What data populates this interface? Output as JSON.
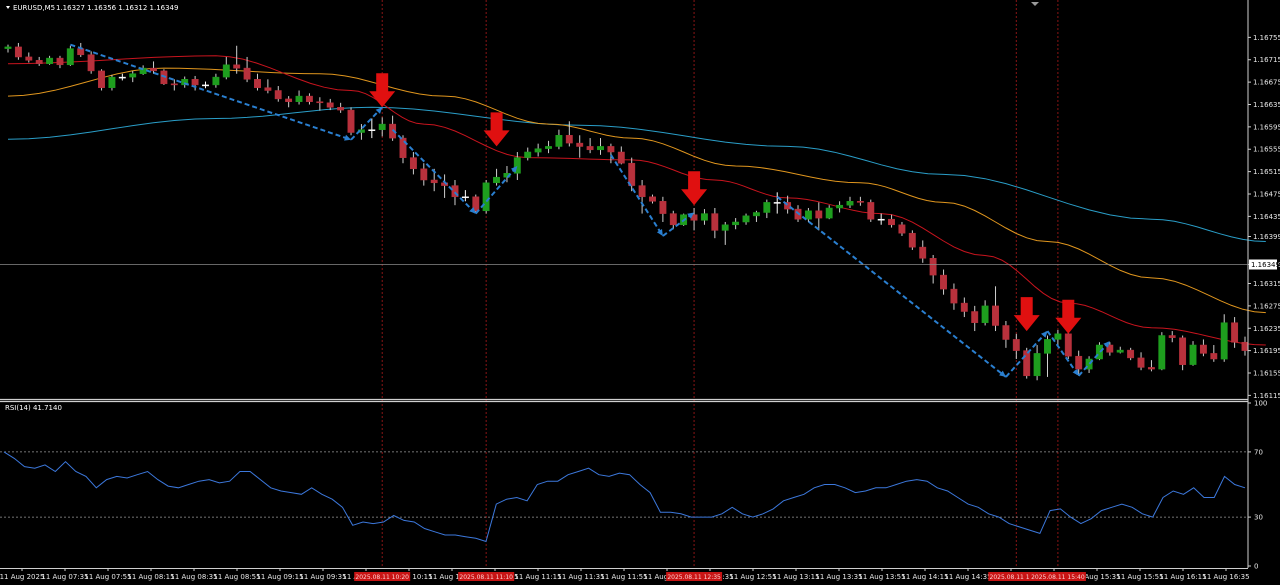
{
  "header": {
    "symbol": "EURUSD,M5",
    "ohlc": "1.16327 1.16356 1.16312 1.16349"
  },
  "rsi_panel": {
    "label": "RSI(14) 41.7140",
    "ticks": [
      "100",
      "70",
      "30",
      "0"
    ]
  },
  "colors": {
    "background": "#000000",
    "bull": "#1e9e1e",
    "bear": "#b8313c",
    "ma_fast": "#c8141e",
    "ma_mid": "#e0961e",
    "ma_slow": "#2a9ec8",
    "rsi": "#3c78dc",
    "grid_vline": "#8a1515",
    "arrow": "#e01010",
    "trend": "#2a7fd0",
    "price_marker_bg": "#ffffff"
  },
  "chart_data": {
    "type": "candlestick",
    "title": "EURUSD,M5",
    "y_ticks": [
      "1.16755",
      "1.16715",
      "1.16675",
      "1.16635",
      "1.16595",
      "1.16555",
      "1.16515",
      "1.16475",
      "1.16435",
      "1.16399",
      "1.16349",
      "1.16315",
      "1.16275",
      "1.16235",
      "1.16195",
      "1.16155",
      "1.16115"
    ],
    "ylim": [
      1.16113,
      1.16778
    ],
    "current_price": "1.16349",
    "x_labels": [
      "11 Aug 2025",
      "11 Aug 07:35",
      "11 Aug 07:55",
      "11 Aug 08:15",
      "11 Aug 08:35",
      "11 Aug 08:55",
      "11 Aug 09:15",
      "11 Aug 09:35",
      "11 Aug 09:55",
      "11 Aug 10:15",
      "11 Aug 10:35",
      "11 Aug 10:55",
      "11 Aug 11:15",
      "11 Aug 11:35",
      "11 Aug 11:55",
      "11 Aug 12:15",
      "11 Aug 12:35",
      "11 Aug 12:55",
      "11 Aug 13:15",
      "11 Aug 13:35",
      "11 Aug 13:55",
      "11 Aug 14:15",
      "11 Aug 14:35",
      "11 Aug 14:55",
      "11 Aug 15:15",
      "11 Aug 15:35",
      "11 Aug 15:55",
      "11 Aug 16:15",
      "11 Aug 16:35"
    ],
    "highlighted_times": [
      "2025.08.11 10:20",
      "2025.08.11 11:10",
      "2025.08.11 12:35",
      "2025.08.11 15:20",
      "2025.08.11 15:40"
    ],
    "ohlc": [
      [
        1.16735,
        1.16742,
        1.16728,
        1.16738
      ],
      [
        1.16738,
        1.16745,
        1.16715,
        1.1672
      ],
      [
        1.1672,
        1.16728,
        1.1671,
        1.16714
      ],
      [
        1.16714,
        1.1672,
        1.16704,
        1.16708
      ],
      [
        1.16708,
        1.16722,
        1.16706,
        1.16718
      ],
      [
        1.16718,
        1.16722,
        1.167,
        1.16706
      ],
      [
        1.16706,
        1.1674,
        1.16704,
        1.16735
      ],
      [
        1.16735,
        1.16745,
        1.1672,
        1.16724
      ],
      [
        1.16724,
        1.1673,
        1.1669,
        1.16695
      ],
      [
        1.16695,
        1.16698,
        1.1666,
        1.16665
      ],
      [
        1.16665,
        1.16688,
        1.1666,
        1.16684
      ],
      [
        1.16684,
        1.1669,
        1.16678,
        1.16684
      ],
      [
        1.16684,
        1.16695,
        1.16675,
        1.1669
      ],
      [
        1.1669,
        1.16705,
        1.16688,
        1.167
      ],
      [
        1.167,
        1.16712,
        1.1669,
        1.16695
      ],
      [
        1.16695,
        1.16698,
        1.1667,
        1.16672
      ],
      [
        1.16672,
        1.1668,
        1.1666,
        1.1667
      ],
      [
        1.1667,
        1.16685,
        1.16665,
        1.1668
      ],
      [
        1.1668,
        1.16686,
        1.1666,
        1.1667
      ],
      [
        1.1667,
        1.16676,
        1.16664,
        1.1667
      ],
      [
        1.1667,
        1.1669,
        1.16665,
        1.16684
      ],
      [
        1.16684,
        1.1672,
        1.1668,
        1.16706
      ],
      [
        1.16706,
        1.1674,
        1.1669,
        1.167
      ],
      [
        1.167,
        1.1672,
        1.16675,
        1.1668
      ],
      [
        1.1668,
        1.1669,
        1.1666,
        1.16665
      ],
      [
        1.16665,
        1.1668,
        1.16655,
        1.1666
      ],
      [
        1.1666,
        1.16668,
        1.1664,
        1.16645
      ],
      [
        1.16645,
        1.1665,
        1.1663,
        1.1664
      ],
      [
        1.1664,
        1.1666,
        1.16635,
        1.1665
      ],
      [
        1.1665,
        1.16655,
        1.16635,
        1.1664
      ],
      [
        1.1664,
        1.16648,
        1.16624,
        1.16638
      ],
      [
        1.16638,
        1.16645,
        1.16625,
        1.1663
      ],
      [
        1.1663,
        1.16638,
        1.1662,
        1.16625
      ],
      [
        1.16625,
        1.1663,
        1.1658,
        1.16585
      ],
      [
        1.16585,
        1.166,
        1.16572,
        1.1659
      ],
      [
        1.1659,
        1.1661,
        1.16575,
        1.1659
      ],
      [
        1.1659,
        1.16612,
        1.16578,
        1.166
      ],
      [
        1.166,
        1.16615,
        1.1657,
        1.16575
      ],
      [
        1.16575,
        1.1658,
        1.1653,
        1.1654
      ],
      [
        1.1654,
        1.1655,
        1.1651,
        1.1652
      ],
      [
        1.1652,
        1.1653,
        1.1649,
        1.165
      ],
      [
        1.165,
        1.1652,
        1.1648,
        1.16495
      ],
      [
        1.16495,
        1.1651,
        1.16468,
        1.1649
      ],
      [
        1.1649,
        1.165,
        1.16455,
        1.1647
      ],
      [
        1.1647,
        1.16482,
        1.16462,
        1.1647
      ],
      [
        1.1647,
        1.16474,
        1.1644,
        1.16445
      ],
      [
        1.16445,
        1.165,
        1.1644,
        1.16495
      ],
      [
        1.16495,
        1.1652,
        1.1649,
        1.16505
      ],
      [
        1.16505,
        1.16525,
        1.16496,
        1.16512
      ],
      [
        1.16512,
        1.1655,
        1.165,
        1.1654
      ],
      [
        1.1654,
        1.16558,
        1.16535,
        1.1655
      ],
      [
        1.1655,
        1.16565,
        1.16542,
        1.16556
      ],
      [
        1.16556,
        1.1657,
        1.16548,
        1.1656
      ],
      [
        1.1656,
        1.1659,
        1.16555,
        1.1658
      ],
      [
        1.1658,
        1.16605,
        1.1656,
        1.16566
      ],
      [
        1.16566,
        1.1658,
        1.1654,
        1.1656
      ],
      [
        1.1656,
        1.16575,
        1.16548,
        1.16554
      ],
      [
        1.16554,
        1.16575,
        1.16545,
        1.1656
      ],
      [
        1.1656,
        1.16565,
        1.1653,
        1.1655
      ],
      [
        1.1655,
        1.1656,
        1.16528,
        1.1653
      ],
      [
        1.1653,
        1.1654,
        1.1648,
        1.1649
      ],
      [
        1.1649,
        1.165,
        1.1644,
        1.1647
      ],
      [
        1.1647,
        1.16474,
        1.16458,
        1.16462
      ],
      [
        1.16462,
        1.1647,
        1.16425,
        1.1644
      ],
      [
        1.1644,
        1.16445,
        1.16412,
        1.1642
      ],
      [
        1.1642,
        1.1644,
        1.16418,
        1.16438
      ],
      [
        1.16438,
        1.1645,
        1.1641,
        1.16428
      ],
      [
        1.16428,
        1.16448,
        1.1642,
        1.1644
      ],
      [
        1.1644,
        1.1645,
        1.16396,
        1.1641
      ],
      [
        1.1641,
        1.16425,
        1.16384,
        1.1642
      ],
      [
        1.1642,
        1.16432,
        1.16412,
        1.16425
      ],
      [
        1.16425,
        1.1644,
        1.1642,
        1.16436
      ],
      [
        1.16436,
        1.16445,
        1.16425,
        1.16442
      ],
      [
        1.16442,
        1.16465,
        1.16432,
        1.1646
      ],
      [
        1.1646,
        1.16478,
        1.1644,
        1.1646
      ],
      [
        1.1646,
        1.16472,
        1.1644,
        1.16448
      ],
      [
        1.16448,
        1.16455,
        1.16425,
        1.1643
      ],
      [
        1.1643,
        1.1645,
        1.16425,
        1.16445
      ],
      [
        1.16445,
        1.1646,
        1.1641,
        1.16432
      ],
      [
        1.16432,
        1.16455,
        1.1643,
        1.1645
      ],
      [
        1.1645,
        1.16462,
        1.16442,
        1.16455
      ],
      [
        1.16455,
        1.1647,
        1.1645,
        1.16462
      ],
      [
        1.16462,
        1.1647,
        1.16454,
        1.1646
      ],
      [
        1.1646,
        1.16465,
        1.16425,
        1.1643
      ],
      [
        1.1643,
        1.1644,
        1.1642,
        1.1643
      ],
      [
        1.1643,
        1.16438,
        1.16415,
        1.1642
      ],
      [
        1.1642,
        1.16425,
        1.164,
        1.16405
      ],
      [
        1.16405,
        1.1641,
        1.16375,
        1.1638
      ],
      [
        1.1638,
        1.16392,
        1.16352,
        1.1636
      ],
      [
        1.1636,
        1.16366,
        1.16315,
        1.1633
      ],
      [
        1.1633,
        1.1634,
        1.16295,
        1.16305
      ],
      [
        1.16305,
        1.16315,
        1.16268,
        1.1628
      ],
      [
        1.1628,
        1.1629,
        1.16255,
        1.16265
      ],
      [
        1.16265,
        1.16275,
        1.1623,
        1.16245
      ],
      [
        1.16245,
        1.16285,
        1.1624,
        1.16275
      ],
      [
        1.16275,
        1.1631,
        1.1623,
        1.1624
      ],
      [
        1.1624,
        1.16248,
        1.162,
        1.16215
      ],
      [
        1.16215,
        1.16225,
        1.1618,
        1.16195
      ],
      [
        1.16195,
        1.162,
        1.16145,
        1.1615
      ],
      [
        1.1615,
        1.16205,
        1.16142,
        1.1619
      ],
      [
        1.1619,
        1.16222,
        1.16148,
        1.16215
      ],
      [
        1.16215,
        1.16232,
        1.16205,
        1.16225
      ],
      [
        1.16225,
        1.16235,
        1.1618,
        1.16185
      ],
      [
        1.16185,
        1.16195,
        1.1615,
        1.16162
      ],
      [
        1.16162,
        1.16185,
        1.16155,
        1.1618
      ],
      [
        1.1618,
        1.1621,
        1.16178,
        1.16205
      ],
      [
        1.16205,
        1.1621,
        1.16186,
        1.16192
      ],
      [
        1.16192,
        1.16202,
        1.1619,
        1.16196
      ],
      [
        1.16196,
        1.162,
        1.16178,
        1.16182
      ],
      [
        1.16182,
        1.16192,
        1.1616,
        1.16165
      ],
      [
        1.16165,
        1.16178,
        1.16158,
        1.16162
      ],
      [
        1.16162,
        1.16228,
        1.1616,
        1.16222
      ],
      [
        1.16222,
        1.1623,
        1.1621,
        1.16218
      ],
      [
        1.16218,
        1.16222,
        1.1616,
        1.1617
      ],
      [
        1.1617,
        1.16212,
        1.16168,
        1.16205
      ],
      [
        1.16205,
        1.16215,
        1.16185,
        1.1619
      ],
      [
        1.1619,
        1.16205,
        1.16175,
        1.1618
      ],
      [
        1.1618,
        1.1626,
        1.16175,
        1.16245
      ],
      [
        1.16245,
        1.16255,
        1.162,
        1.1621
      ],
      [
        1.1621,
        1.1622,
        1.16186,
        1.16195
      ]
    ],
    "ma_fast": [
      [
        0,
        1.16708
      ],
      [
        20,
        1.16722
      ],
      [
        33,
        1.1666
      ],
      [
        40,
        1.166
      ],
      [
        50,
        1.1654
      ],
      [
        60,
        1.16536
      ],
      [
        68,
        1.165
      ],
      [
        75,
        1.16468
      ],
      [
        84,
        1.1644
      ],
      [
        94,
        1.16365
      ],
      [
        102,
        1.1628
      ],
      [
        110,
        1.16236
      ],
      [
        121,
        1.16205
      ]
    ],
    "ma_mid": [
      [
        0,
        1.1665
      ],
      [
        15,
        1.167
      ],
      [
        30,
        1.1669
      ],
      [
        42,
        1.1665
      ],
      [
        52,
        1.166
      ],
      [
        60,
        1.16575
      ],
      [
        70,
        1.16525
      ],
      [
        82,
        1.16495
      ],
      [
        90,
        1.1646
      ],
      [
        100,
        1.1639
      ],
      [
        110,
        1.16325
      ],
      [
        121,
        1.16263
      ]
    ],
    "ma_slow": [
      [
        0,
        1.16573
      ],
      [
        20,
        1.1661
      ],
      [
        35,
        1.1663
      ],
      [
        55,
        1.16598
      ],
      [
        75,
        1.1656
      ],
      [
        90,
        1.1651
      ],
      [
        110,
        1.1643
      ],
      [
        121,
        1.1639
      ]
    ],
    "trend_lines": [
      [
        [
          6,
          1.16742
        ],
        [
          33,
          1.16572
        ]
      ],
      [
        [
          33,
          1.16572
        ],
        [
          36,
          1.1663
        ]
      ],
      [
        [
          37,
          1.1659
        ],
        [
          45,
          1.1644
        ]
      ],
      [
        [
          45,
          1.1644
        ],
        [
          49,
          1.16525
        ]
      ],
      [
        [
          58,
          1.16545
        ],
        [
          63,
          1.164
        ]
      ],
      [
        [
          63,
          1.164
        ],
        [
          66,
          1.16442
        ]
      ],
      [
        [
          74,
          1.1647
        ],
        [
          96,
          1.16148
        ]
      ],
      [
        [
          96,
          1.16148
        ],
        [
          100,
          1.1623
        ]
      ],
      [
        [
          100,
          1.1623
        ],
        [
          103,
          1.1615
        ]
      ],
      [
        [
          103,
          1.1615
        ],
        [
          106,
          1.16212
        ]
      ]
    ],
    "signal_arrows": [
      [
        36,
        1.1663
      ],
      [
        47,
        1.1656
      ],
      [
        66,
        1.16455
      ],
      [
        98,
        1.1623
      ],
      [
        102,
        1.16225
      ]
    ],
    "rsi": [
      70,
      66,
      61,
      60,
      62,
      58,
      64,
      58,
      55,
      48,
      53,
      55,
      54,
      56,
      58,
      53,
      49,
      48,
      50,
      52,
      53,
      51,
      52,
      58,
      58,
      53,
      48,
      46,
      45,
      44,
      48,
      44,
      41,
      36,
      25,
      27,
      26,
      27,
      31,
      28,
      27,
      23,
      21,
      19,
      19,
      18,
      17,
      15,
      38,
      41,
      42,
      40,
      50,
      52,
      52,
      56,
      58,
      60,
      56,
      55,
      57,
      56,
      50,
      45,
      33,
      33,
      32,
      30,
      30,
      30,
      32,
      36,
      32,
      30,
      32,
      35,
      40,
      42,
      44,
      48,
      50,
      50,
      48,
      45,
      46,
      48,
      48,
      50,
      52,
      53,
      52,
      48,
      46,
      42,
      38,
      36,
      32,
      30,
      26,
      24,
      22,
      20,
      34,
      35,
      30,
      26,
      29,
      34,
      36,
      38,
      36,
      32,
      30,
      42,
      46,
      44,
      48,
      42,
      42,
      55,
      50,
      48
    ]
  }
}
